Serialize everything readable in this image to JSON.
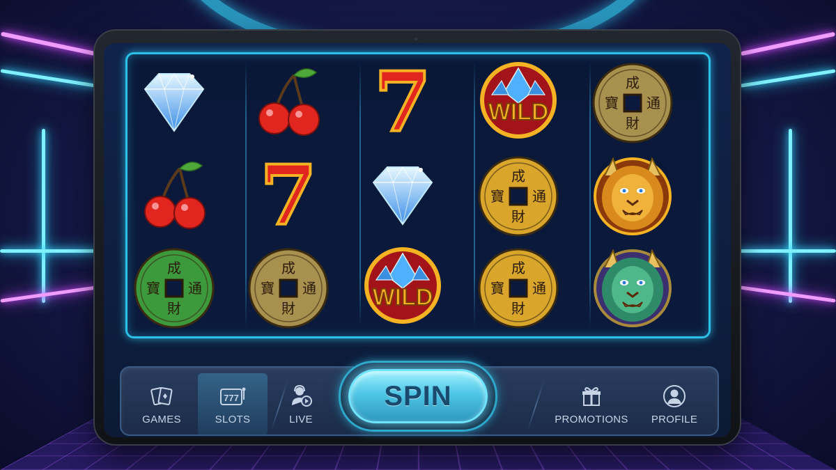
{
  "colors": {
    "accent": "#2cc0e6",
    "spin_button": "#4fc6e6",
    "nav_text": "#c6d4e6",
    "coin_gold": "#d9a52a",
    "coin_bronze": "#a8904e",
    "coin_green": "#3c9a3c",
    "seven_red": "#e0261e",
    "wild_gold": "#f5b323"
  },
  "reels": [
    {
      "symbols": [
        {
          "type": "diamond",
          "icon": "diamond-icon"
        },
        {
          "type": "cherry",
          "icon": "cherry-icon"
        },
        {
          "type": "coin",
          "icon": "coin-icon",
          "variant": "green",
          "chars": [
            "成",
            "寶",
            "通",
            "財"
          ]
        }
      ]
    },
    {
      "symbols": [
        {
          "type": "cherry",
          "icon": "cherry-icon"
        },
        {
          "type": "seven",
          "icon": "seven-icon",
          "text": "7"
        },
        {
          "type": "coin",
          "icon": "coin-icon",
          "variant": "bronze",
          "chars": [
            "成",
            "寶",
            "通",
            "財"
          ]
        }
      ]
    },
    {
      "symbols": [
        {
          "type": "seven",
          "icon": "seven-icon",
          "text": "7"
        },
        {
          "type": "diamond",
          "icon": "diamond-icon"
        },
        {
          "type": "wild",
          "icon": "wild-icon",
          "text": "WILD"
        }
      ]
    },
    {
      "symbols": [
        {
          "type": "wild",
          "icon": "wild-icon",
          "text": "WILD"
        },
        {
          "type": "coin",
          "icon": "coin-icon",
          "variant": "gold",
          "chars": [
            "成",
            "寶",
            "通",
            "財"
          ]
        },
        {
          "type": "coin",
          "icon": "coin-icon",
          "variant": "gold",
          "chars": [
            "成",
            "寶",
            "通",
            "財"
          ]
        }
      ]
    },
    {
      "symbols": [
        {
          "type": "coin",
          "icon": "coin-icon",
          "variant": "bronze",
          "chars": [
            "成",
            "寶",
            "通",
            "財"
          ]
        },
        {
          "type": "lion",
          "icon": "golden-lion-icon",
          "variant": "gold"
        },
        {
          "type": "lion",
          "icon": "jade-dragon-icon",
          "variant": "green"
        }
      ]
    }
  ],
  "nav": {
    "games": {
      "label": "GAMES",
      "icon": "playing-cards-icon"
    },
    "slots": {
      "label": "SLOTS",
      "icon": "slot-machine-icon",
      "active": true
    },
    "live": {
      "label": "LIVE",
      "icon": "live-dealer-icon"
    },
    "promotions": {
      "label": "PROMOTIONS",
      "icon": "gift-icon"
    },
    "profile": {
      "label": "PROFILE",
      "icon": "user-icon"
    }
  },
  "spin": {
    "label": "SPIN"
  }
}
